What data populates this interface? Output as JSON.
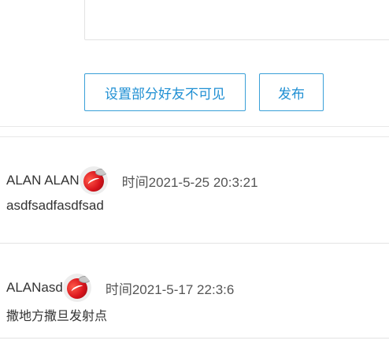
{
  "composer": {
    "value": "",
    "privacy_button_label": "设置部分好友不可见",
    "publish_button_label": "发布"
  },
  "posts": [
    {
      "author": "ALAN ALAN",
      "time_prefix": "时间",
      "time_value": "2021-5-25 20:3:21",
      "content": "asdfsadfasdfsad",
      "avatar_icon": "coke-can-avatar-icon"
    },
    {
      "author": "ALANasd",
      "time_prefix": "时间",
      "time_value": "2021-5-17 22:3:6",
      "content": "撒地方撒旦发射点",
      "avatar_icon": "coke-can-avatar-icon"
    }
  ],
  "colors": {
    "accent": "#1f8fd3",
    "border_accent": "#3aa0d8",
    "divider": "#e8e8e8",
    "text": "#333333"
  }
}
